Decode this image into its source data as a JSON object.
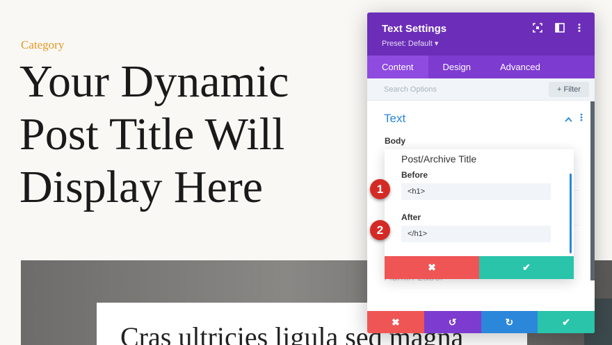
{
  "page": {
    "category": "Category",
    "title": "Your Dynamic Post Title Will Display Here",
    "hero_text": "Cras ultricies ligula sed magna"
  },
  "panel": {
    "title": "Text Settings",
    "preset": "Preset: Default ▾",
    "tabs": [
      "Content",
      "Design",
      "Advanced"
    ],
    "search_placeholder": "Search Options",
    "filter_label": "+ Filter",
    "section_title": "Text",
    "body_label": "Body",
    "admin_label": "Admin Label",
    "footer": {
      "cancel": "✖",
      "undo": "↺",
      "redo": "↻",
      "save": "✔"
    }
  },
  "popup": {
    "title": "Post/Archive Title",
    "before_label": "Before",
    "before_value": "<h1>",
    "after_label": "After",
    "after_value": "</h1>",
    "cancel": "✖",
    "confirm": "✔"
  },
  "markers": [
    "1",
    "2"
  ],
  "colors": {
    "header": "#6c2eb9",
    "tabs": "#7e3bd0",
    "accent": "#2b87da",
    "cancel": "#ef5555",
    "save": "#29c4a9",
    "undo": "#7d3bcf",
    "redo": "#2b87da",
    "category": "#e09a25"
  },
  "icons": [
    "fullscreen-icon",
    "split-view-icon",
    "more-icon",
    "chevron-up-icon"
  ]
}
